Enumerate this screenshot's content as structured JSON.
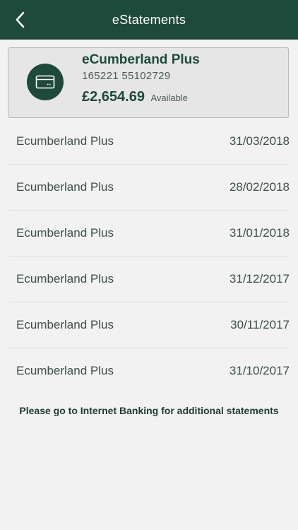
{
  "header": {
    "title": "eStatements",
    "back_icon": "chevron-left-icon"
  },
  "account": {
    "icon": "card-icon",
    "name": "eCumberland Plus",
    "number": "165221 55102729",
    "balance": "£2,654.69",
    "balance_label": "Available"
  },
  "statements": [
    {
      "name": "Ecumberland Plus",
      "date": "31/03/2018"
    },
    {
      "name": "Ecumberland Plus",
      "date": "28/02/2018"
    },
    {
      "name": "Ecumberland Plus",
      "date": "31/01/2018"
    },
    {
      "name": "Ecumberland Plus",
      "date": "31/12/2017"
    },
    {
      "name": "Ecumberland Plus",
      "date": "30/11/2017"
    },
    {
      "name": "Ecumberland Plus",
      "date": "31/10/2017"
    }
  ],
  "footer": {
    "note": "Please go to Internet Banking for additional statements"
  },
  "colors": {
    "brand": "#1e4a3b",
    "background": "#f2f2f2",
    "card_background": "#e6e6e6"
  }
}
